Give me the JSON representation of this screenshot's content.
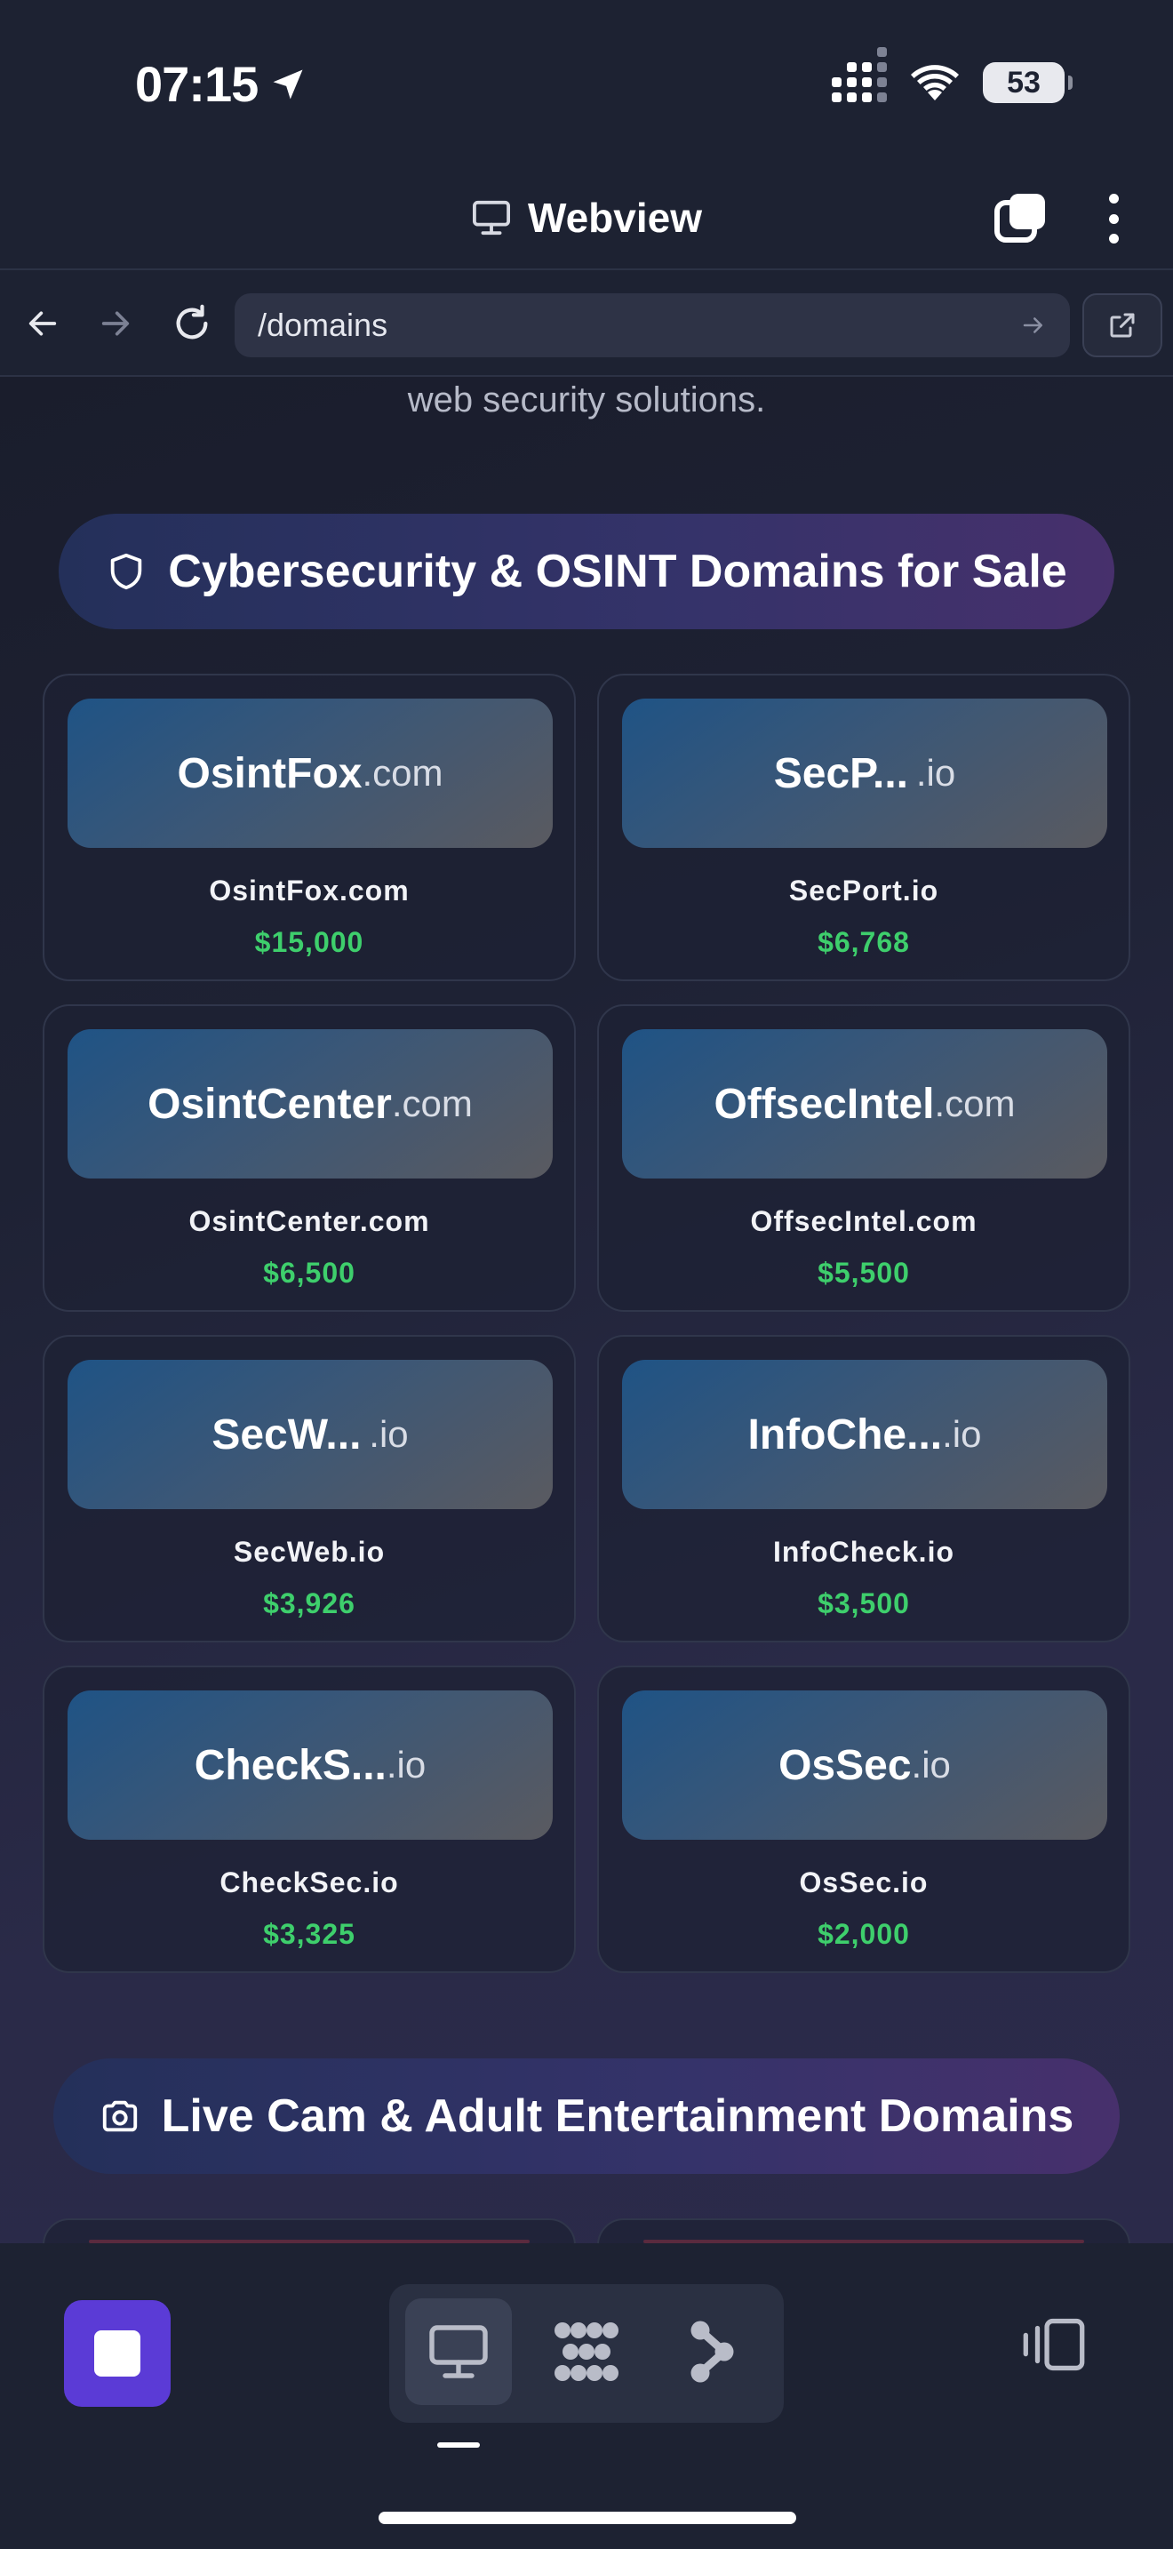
{
  "status_bar": {
    "time": "07:15",
    "battery": "53"
  },
  "title_bar": {
    "title": "Webview"
  },
  "address_bar": {
    "url": "/domains"
  },
  "page": {
    "intro_tail": "web security solutions.",
    "sections": [
      {
        "title": "Cybersecurity & OSINT Domains for Sale",
        "icon": "shield-icon"
      },
      {
        "title": "Live Cam & Adult Entertainment Domains",
        "icon": "camera-icon"
      }
    ],
    "cards": [
      {
        "logo_name": "OsintFox",
        "logo_tld": ".com",
        "domain": "OsintFox.com",
        "price": "$15,000"
      },
      {
        "logo_name": "SecP...",
        "logo_tld": ".io",
        "domain": "SecPort.io",
        "price": "$6,768"
      },
      {
        "logo_name": "OsintCenter",
        "logo_tld": ".com",
        "domain": "OsintCenter.com",
        "price": "$6,500"
      },
      {
        "logo_name": "OffsecIntel",
        "logo_tld": ".com",
        "domain": "OffsecIntel.com",
        "price": "$5,500"
      },
      {
        "logo_name": "SecW...",
        "logo_tld": ".io",
        "domain": "SecWeb.io",
        "price": "$3,926"
      },
      {
        "logo_name": "InfoChe...",
        "logo_tld": ".io",
        "domain": "InfoCheck.io",
        "price": "$3,500"
      },
      {
        "logo_name": "CheckS...",
        "logo_tld": ".io",
        "domain": "CheckSec.io",
        "price": "$3,325"
      },
      {
        "logo_name": "OsSec",
        "logo_tld": ".io",
        "domain": "OsSec.io",
        "price": "$2,000"
      }
    ]
  },
  "toolbar": {
    "modes": [
      "desktop-icon",
      "apps-grid-icon",
      "flow-icon"
    ],
    "active_mode": 0
  },
  "colors": {
    "accent": "#5b3bd6",
    "price": "#3ecf6c",
    "background": "#1b1f2e"
  }
}
